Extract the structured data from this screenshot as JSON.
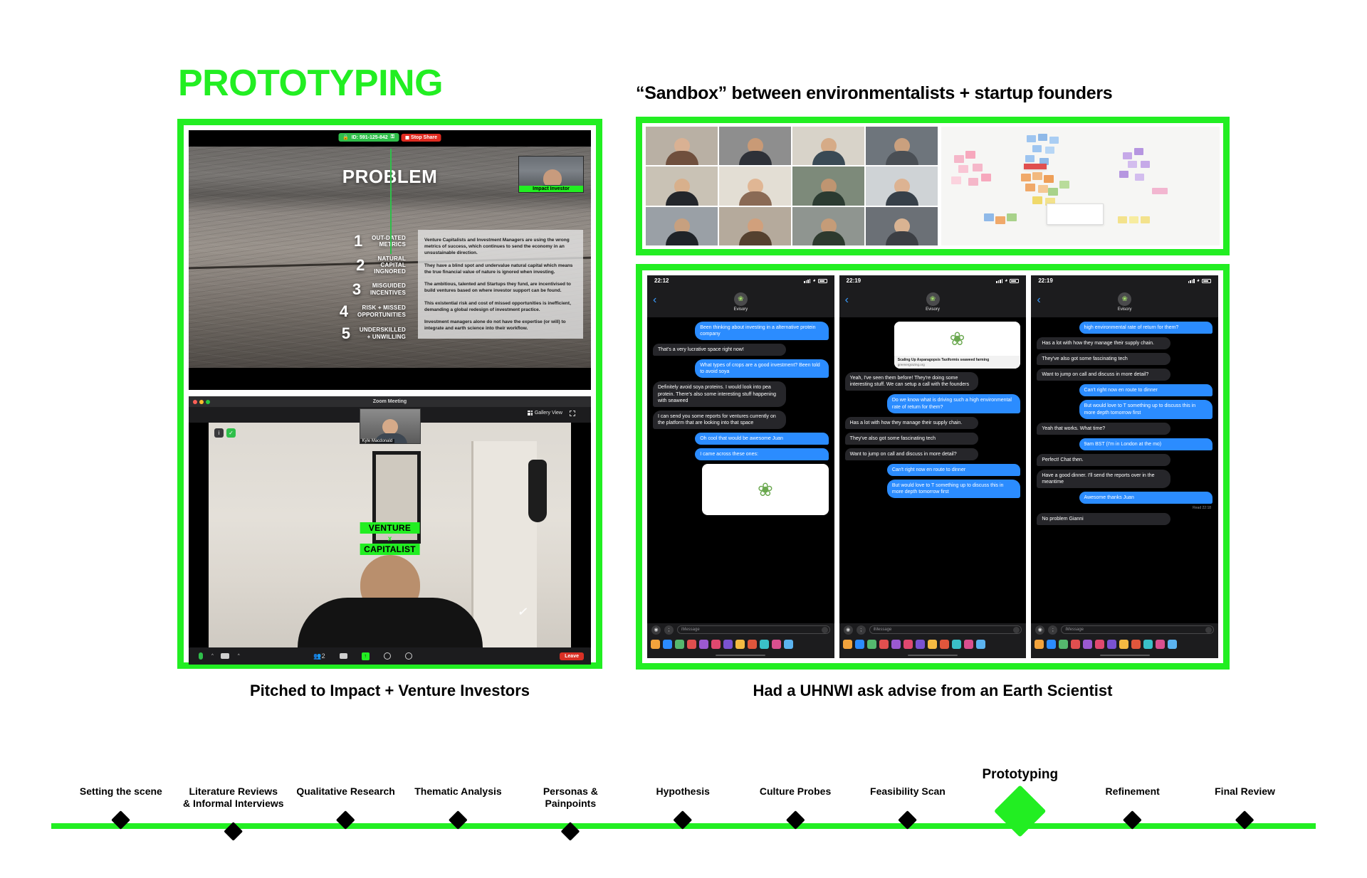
{
  "headings": {
    "main_title": "PROTOTYPING",
    "sandbox_title": "“Sandbox” between environmentalists + startup founders",
    "caption_left": "Pitched to Impact + Venture Investors",
    "caption_right": "Had a UHNWI ask advise from an Earth Scientist"
  },
  "colors": {
    "accent_green": "#22ee22",
    "imessage_blue": "#2b8cff",
    "imessage_gray": "#26262a",
    "leave_red": "#d93025"
  },
  "slide": {
    "share_id": "ID: 591-125-842",
    "stop_share": "Stop Share",
    "title": "PROBLEM",
    "investor_label": "Impact Investor",
    "items": [
      {
        "num": "1",
        "label": "OUT-DATED\nMETRICS"
      },
      {
        "num": "2",
        "label": "NATURAL\nCAPITAL\nINGNORED"
      },
      {
        "num": "3",
        "label": "MISGUIDED\nINCENTIVES"
      },
      {
        "num": "4",
        "label": "RISK + MISSED\nOPPORTUNITIES"
      },
      {
        "num": "5",
        "label": "UNDERSKILLED\n+ UNWILLING"
      }
    ],
    "paragraphs": [
      "Venture Capitalists and Investment Managers are using the wrong metrics of success, which continues to send the economy in an unsustainable direction.",
      "They have a blind spot and undervalue natural capital which means the true financial value of nature is ignored when investing.",
      "The ambitious, talented and Startups they fund, are incentivised to build ventures based on where investor support can be found.",
      "This existential risk and cost of missed opportunities is inefficient, demanding a global redesign of investment practice.",
      "Investment managers alone do not have the expertise (or will) to integrate and earth science into their workflow."
    ]
  },
  "zoom_window": {
    "title": "Zoom Meeting",
    "gallery_view": "Gallery View",
    "self_name": "Kyle Macdonald",
    "badge_line1": "VENTURE",
    "badge_x": "x",
    "badge_line2": "CAPITALIST",
    "toolbar": {
      "mute": "Mute",
      "video": "Stop Video",
      "participants": "2",
      "chat": "Chat",
      "share": "Share Screen",
      "record": "Record",
      "reactions": "Reactions",
      "leave": "Leave"
    }
  },
  "video_grid": {
    "participants": [
      {
        "name": "",
        "skin": "#d9b193",
        "shirt": "#6f4f3d",
        "bg": "#b9b0a4"
      },
      {
        "name": "",
        "skin": "#c99a76",
        "shirt": "#2e3138",
        "bg": "#8e8e8e"
      },
      {
        "name": "",
        "skin": "#d6ab87",
        "shirt": "#3a4a55",
        "bg": "#d8d3c9"
      },
      {
        "name": "",
        "skin": "#caa07e",
        "shirt": "#4a4f55",
        "bg": "#6e757c"
      },
      {
        "name": "",
        "skin": "#d8b08c",
        "shirt": "#23262b",
        "bg": "#c9c2b5"
      },
      {
        "name": "",
        "skin": "#e0b694",
        "shirt": "#8a6a55",
        "bg": "#e3ded4"
      },
      {
        "name": "",
        "skin": "#bf9571",
        "shirt": "#2b3b31",
        "bg": "#7d8a7a"
      },
      {
        "name": "",
        "skin": "#ddb392",
        "shirt": "#374049",
        "bg": "#cfd3d6"
      },
      {
        "name": "",
        "skin": "#c7a07f",
        "shirt": "#1f2328",
        "bg": "#9aa0a6"
      },
      {
        "name": "",
        "skin": "#d1a07c",
        "shirt": "#55412f",
        "bg": "#b5aa9c"
      },
      {
        "name": "",
        "skin": "#c59c78",
        "shirt": "#2d3a2e",
        "bg": "#8f9590"
      },
      {
        "name": "",
        "skin": "#d9b392",
        "shirt": "#3c3f44",
        "bg": "#6b7076"
      }
    ]
  },
  "phones": [
    {
      "time": "22:12",
      "contact": "Evisory",
      "input_placeholder": "iMessage",
      "read_receipt": "",
      "messages": [
        {
          "side": "out",
          "text": "Been thinking about investing in a alternative protein company"
        },
        {
          "side": "in",
          "text": "That's a very lucrative space right now!"
        },
        {
          "side": "out",
          "text": "What types of crops are a good investment? Been told to avoid soya"
        },
        {
          "side": "in",
          "text": "Definitely avoid soya proteins. I would look into pea protein. There's also some interesting stuff happening with seaweed"
        },
        {
          "side": "in",
          "text": "I can send you some reports for ventures currently on the platform that are looking into that space"
        },
        {
          "side": "out",
          "text": "Oh cool that would be awesome Juan"
        },
        {
          "side": "out",
          "text": "I came across these ones:"
        }
      ]
    },
    {
      "time": "22:19",
      "contact": "Evisory",
      "input_placeholder": "iMessage",
      "link_card": {
        "title": "Scaling Up Asparagopsis Taxiformis seaweed farming",
        "domain": "greenergrazing.org"
      },
      "messages": [
        {
          "side": "in",
          "text": "Yeah, I've seen them before! They're doing some interesting stuff. We can setup a call with the founders"
        },
        {
          "side": "out",
          "text": "Do we know what is driving such a high environmental rate of return for them?"
        },
        {
          "side": "in",
          "text": "Has a lot with how they manage their supply chain."
        },
        {
          "side": "in",
          "text": "They've also got some fascinating tech"
        },
        {
          "side": "in",
          "text": "Want to jump on call and discuss in more detail?"
        },
        {
          "side": "out",
          "text": "Can't right now en route to dinner"
        },
        {
          "side": "out",
          "text": "But would love to T something up to discuss this in more depth tomorrow first"
        }
      ]
    },
    {
      "time": "22:19",
      "contact": "Evisory",
      "input_placeholder": "iMessage",
      "read_receipt": "Read 22:18",
      "messages": [
        {
          "side": "out",
          "text": "high environmental rate of return for them?"
        },
        {
          "side": "in",
          "text": "Has a lot with how they manage their supply chain."
        },
        {
          "side": "in",
          "text": "They've also got some fascinating tech"
        },
        {
          "side": "in",
          "text": "Want to jump on call and discuss in more detail?"
        },
        {
          "side": "out",
          "text": "Can't right now en route to dinner"
        },
        {
          "side": "out",
          "text": "But would love to T something up to discuss this in more depth tomorrow first"
        },
        {
          "side": "in",
          "text": "Yeah that works. What time?"
        },
        {
          "side": "out",
          "text": "9am BST (I'm in London at the mo)"
        },
        {
          "side": "in",
          "text": "Perfect! Chat then."
        },
        {
          "side": "in",
          "text": "Have a good dinner. I'll send the reports over in the meantime"
        },
        {
          "side": "out",
          "text": "Awesome thanks Juan"
        },
        {
          "side": "in",
          "text": "No problem Gianni"
        }
      ]
    }
  ],
  "timeline": {
    "nodes": [
      {
        "label": "Setting the scene",
        "active": false
      },
      {
        "label": "Literature Reviews\n& Informal Interviews",
        "active": false
      },
      {
        "label": "Qualitative Research",
        "active": false
      },
      {
        "label": "Thematic Analysis",
        "active": false
      },
      {
        "label": "Personas &\nPainpoints",
        "active": false
      },
      {
        "label": "Hypothesis",
        "active": false
      },
      {
        "label": "Culture Probes",
        "active": false
      },
      {
        "label": "Feasibility Scan",
        "active": false
      },
      {
        "label": "Prototyping",
        "active": true
      },
      {
        "label": "Refinement",
        "active": false
      },
      {
        "label": "Final Review",
        "active": false
      }
    ]
  }
}
